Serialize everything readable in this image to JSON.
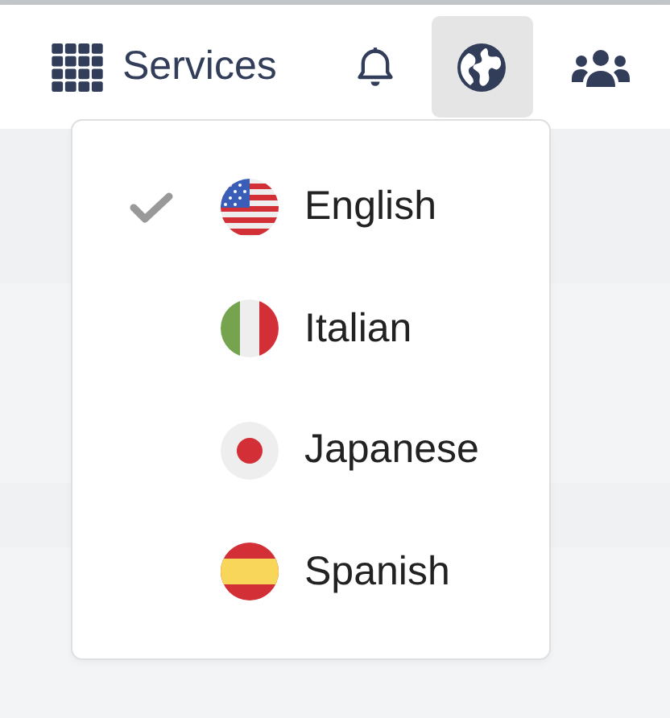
{
  "header": {
    "services_label": "Services",
    "language_menu_open": true
  },
  "language_menu": [
    {
      "label": "English",
      "kind": "us",
      "selected": true
    },
    {
      "label": "Italian",
      "kind": "it",
      "selected": false
    },
    {
      "label": "Japanese",
      "kind": "jp",
      "selected": false
    },
    {
      "label": "Spanish",
      "kind": "es",
      "selected": false
    }
  ]
}
